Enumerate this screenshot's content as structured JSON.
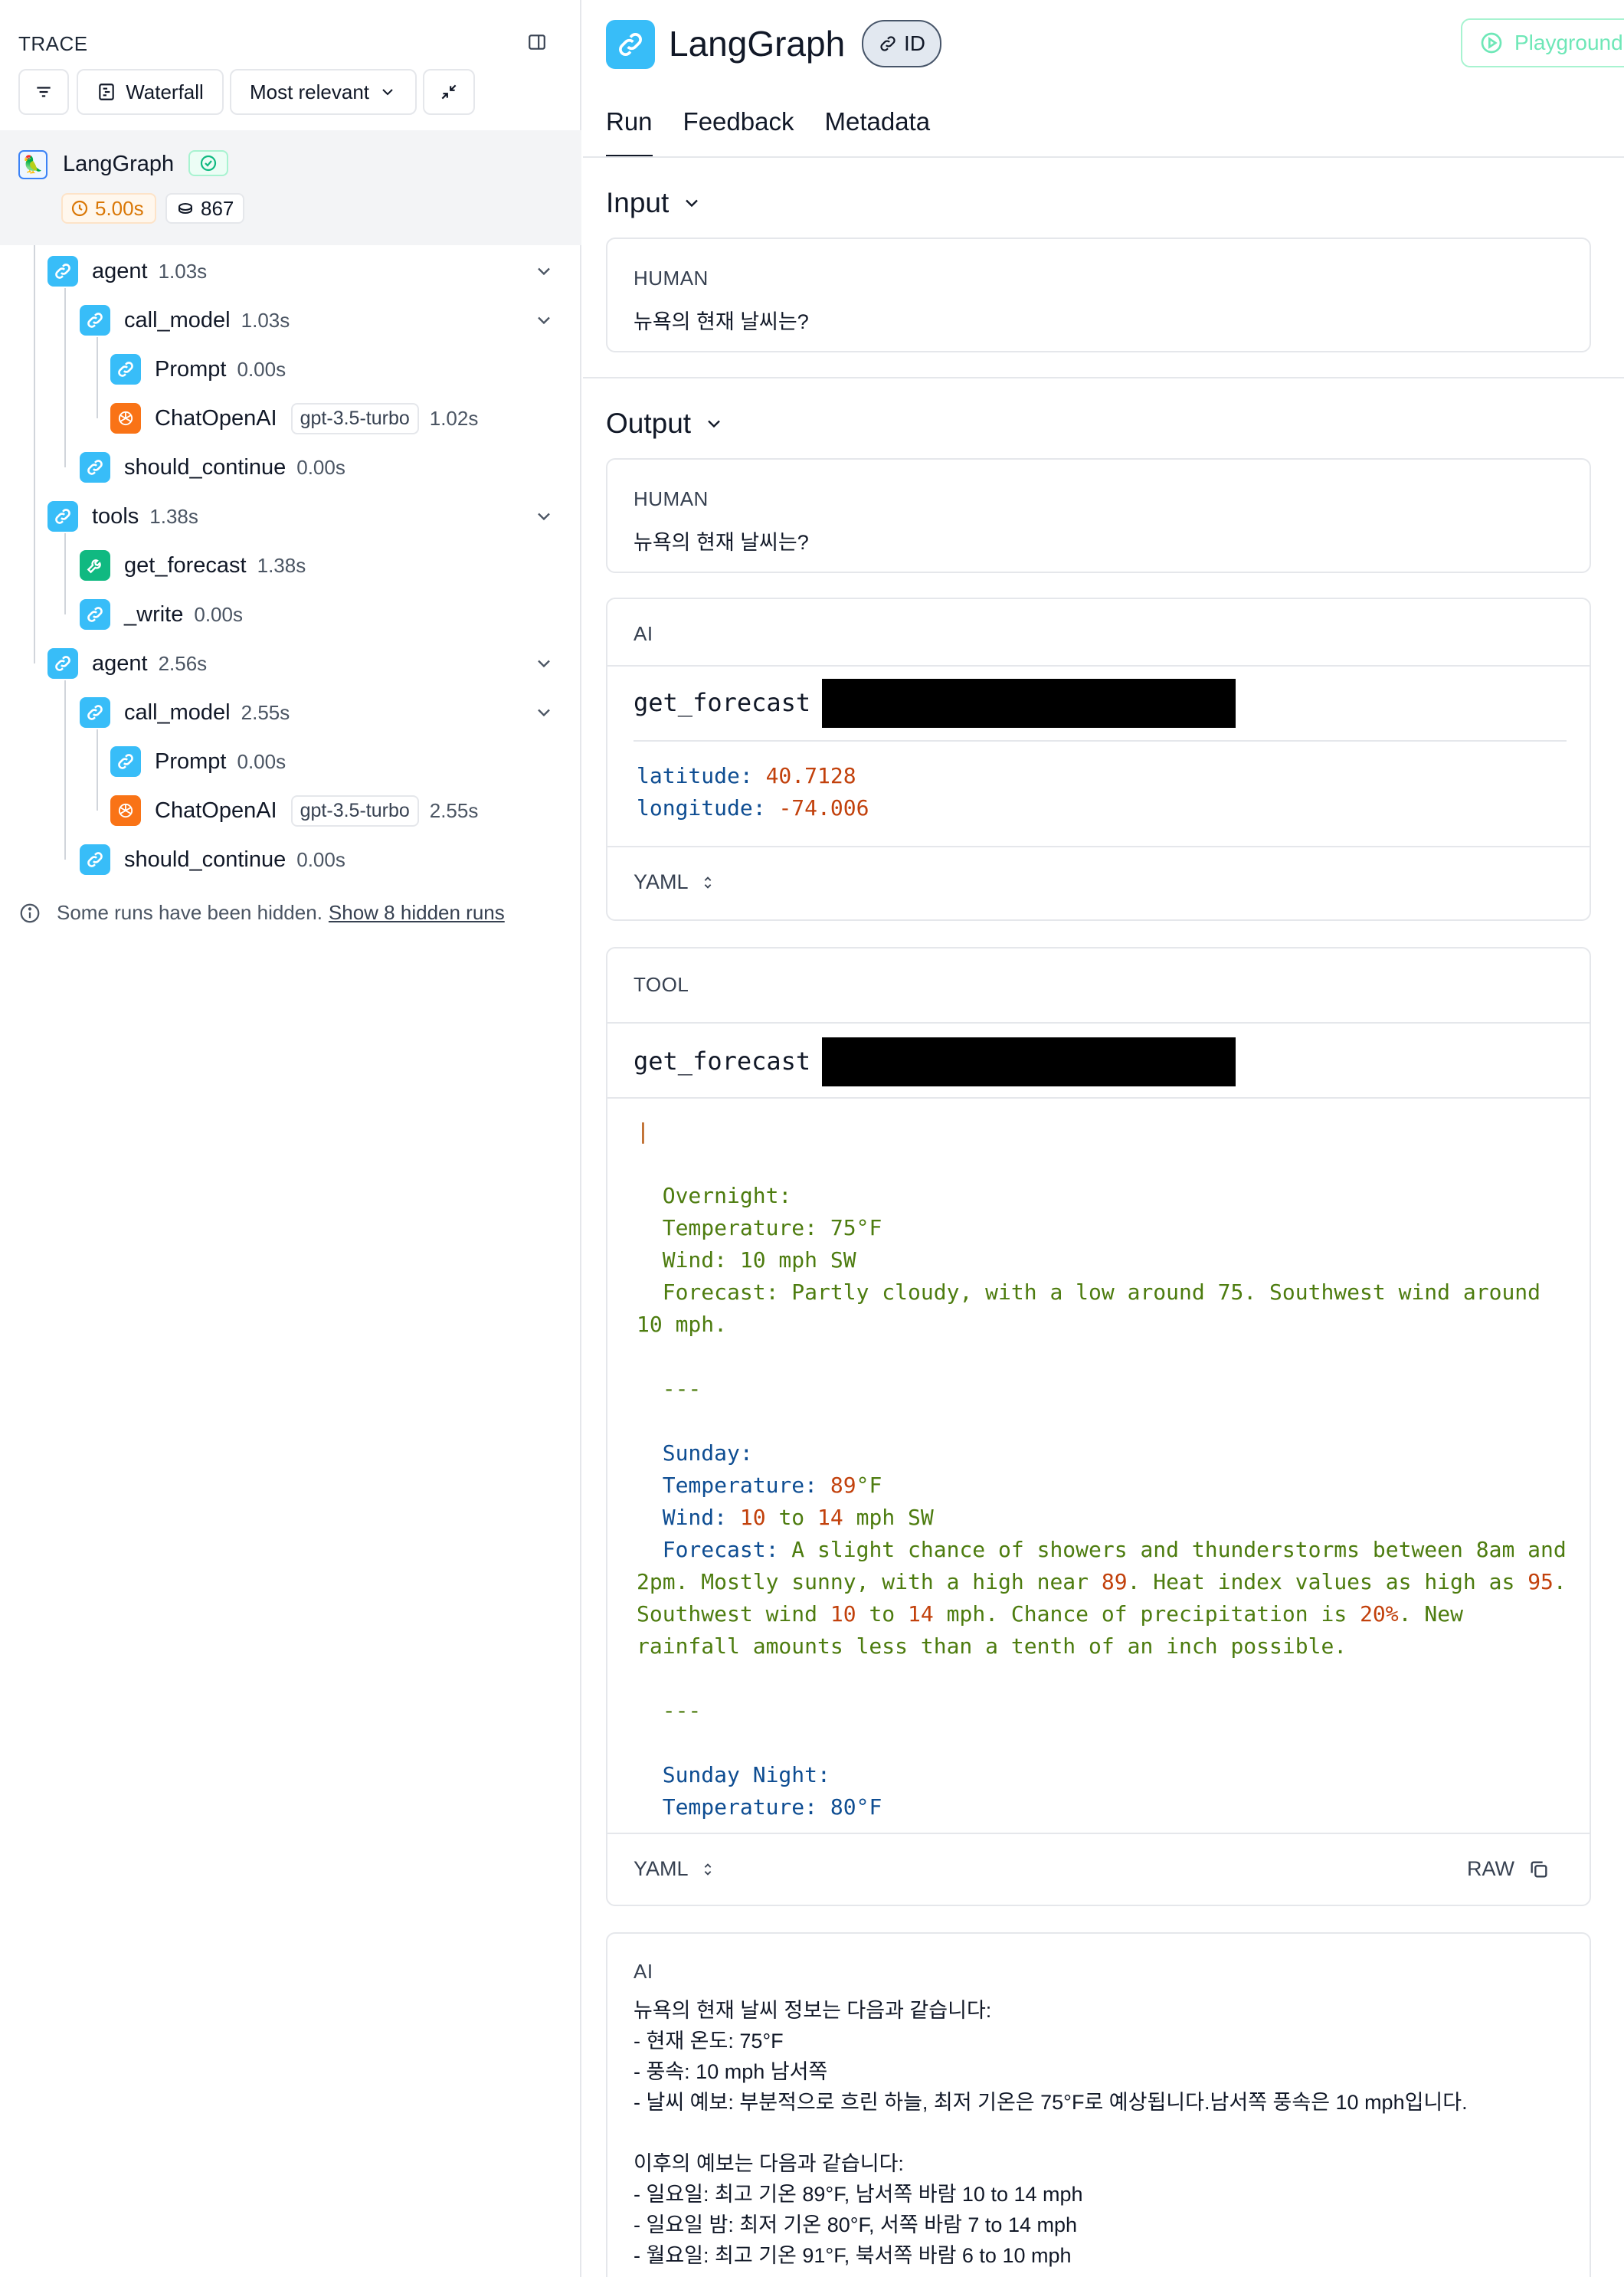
{
  "trace": {
    "title": "TRACE",
    "toolbar": {
      "waterfall_label": "Waterfall",
      "sort_label": "Most relevant"
    },
    "root": {
      "name": "LangGraph",
      "duration": "5.00s",
      "tokens": "867"
    },
    "nodes": [
      {
        "name": "agent",
        "time": "1.03s",
        "icon": "chain-icon"
      },
      {
        "name": "call_model",
        "time": "1.03s",
        "icon": "chain-icon"
      },
      {
        "name": "Prompt",
        "time": "0.00s",
        "icon": "chain-icon"
      },
      {
        "name": "ChatOpenAI",
        "model": "gpt-3.5-turbo",
        "time": "1.02s",
        "icon": "openai-icon"
      },
      {
        "name": "should_continue",
        "time": "0.00s",
        "icon": "chain-icon"
      },
      {
        "name": "tools",
        "time": "1.38s",
        "icon": "chain-icon"
      },
      {
        "name": "get_forecast",
        "time": "1.38s",
        "icon": "wrench-icon"
      },
      {
        "name": "_write",
        "time": "0.00s",
        "icon": "chain-icon"
      },
      {
        "name": "agent",
        "time": "2.56s",
        "icon": "chain-icon"
      },
      {
        "name": "call_model",
        "time": "2.55s",
        "icon": "chain-icon"
      },
      {
        "name": "Prompt",
        "time": "0.00s",
        "icon": "chain-icon"
      },
      {
        "name": "ChatOpenAI",
        "model": "gpt-3.5-turbo",
        "time": "2.55s",
        "icon": "openai-icon"
      },
      {
        "name": "should_continue",
        "time": "0.00s",
        "icon": "chain-icon"
      }
    ],
    "hidden_note": "Some runs have been hidden.",
    "hidden_link": "Show 8 hidden runs"
  },
  "run": {
    "title": "LangGraph",
    "id_label": "ID",
    "playground_label": "Playground",
    "tabs": [
      "Run",
      "Feedback",
      "Metadata"
    ],
    "input": {
      "title": "Input",
      "messages": [
        {
          "role": "HUMAN",
          "content": "뉴욕의 현재 날씨는?"
        }
      ]
    },
    "output": {
      "title": "Output",
      "human": {
        "role": "HUMAN",
        "content": "뉴욕의 현재 날씨는?"
      },
      "ai_call": {
        "role": "AI",
        "function": "get_forecast",
        "args": {
          "latitude_key": "latitude:",
          "latitude": "40.7128",
          "longitude_key": "longitude:",
          "longitude": "-74.006"
        },
        "format": "YAML"
      },
      "tool": {
        "role": "TOOL",
        "function": "get_forecast",
        "format": "YAML",
        "raw_label": "RAW",
        "pipe": "|",
        "overnight_head": "Overnight:",
        "overnight_temp": "Temperature: 75°F",
        "overnight_wind": "Wind: 10 mph SW",
        "overnight_forecast": "Forecast: Partly cloudy, with a low around 75. Southwest wind around 10 mph.",
        "sep1": "---",
        "sunday_head": "Sunday:",
        "sunday_temp_k": "Temperature:",
        "sunday_temp_v": "89",
        "sunday_temp_u": "°F",
        "sunday_wind_k": "Wind:",
        "sunday_wind_v1": "10",
        "sunday_wind_to": "to",
        "sunday_wind_v2": "14",
        "sunday_wind_u": "mph SW",
        "sunday_fc_k": "Forecast:",
        "sunday_fc_1": "A slight chance of showers and thunderstorms between 8am and 2pm. Mostly sunny, with a high near",
        "sunday_fc_2": "89",
        "sunday_fc_3": ". Heat index values as high as",
        "sunday_fc_4": "95",
        "sunday_fc_5": ". Southwest wind",
        "sunday_fc_6": "10",
        "sunday_fc_7": "to",
        "sunday_fc_8": "14",
        "sunday_fc_9": "mph. Chance of precipitation is",
        "sunday_fc_10": "20%",
        "sunday_fc_11": ". New rainfall amounts less than a tenth of an inch possible.",
        "sep2": "---",
        "sunday_night_head": "Sunday Night:",
        "sunday_night_temp": "Temperature: 80°F"
      },
      "ai_reply": {
        "role": "AI",
        "lines": [
          "뉴욕의 현재 날씨 정보는 다음과 같습니다:",
          "- 현재 온도: 75°F",
          "- 풍속: 10 mph 남서쪽",
          "- 날씨 예보: 부분적으로 흐린 하늘, 최저 기온은 75°F로 예상됩니다.남서쪽 풍속은 10 mph입니다.",
          "",
          "이후의 예보는 다음과 같습니다:",
          "- 일요일: 최고 기온 89°F, 남서쪽 바람 10 to 14 mph",
          "- 일요일 밤: 최저 기온 80°F, 서쪽 바람 7 to 14 mph",
          "- 월요일: 최고 기온 91°F, 북서쪽 바람 6 to 10 mph"
        ]
      }
    }
  },
  "colors": {
    "chain": "#38bdf8",
    "llm": "#f97316",
    "tool": "#10b981",
    "yaml_key": "#0e4d92",
    "yaml_num": "#c2410c",
    "yaml_str": "#4d7c0f"
  }
}
